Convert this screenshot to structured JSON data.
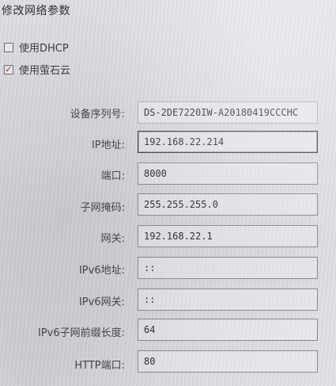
{
  "dialog": {
    "title": "修改网络参数"
  },
  "options": {
    "dhcp": {
      "label": "使用DHCP",
      "checked": false
    },
    "ezviz": {
      "label": "使用萤石云",
      "checked": true
    }
  },
  "fields": [
    {
      "key": "serial",
      "label": "设备序列号:",
      "value": "DS-2DE7220IW-A20180419CCCHC"
    },
    {
      "key": "ip",
      "label": "IP地址:",
      "value": "192.168.22.214"
    },
    {
      "key": "port",
      "label": "端口:",
      "value": "8000"
    },
    {
      "key": "mask",
      "label": "子网掩码:",
      "value": "255.255.255.0"
    },
    {
      "key": "gateway",
      "label": "网关:",
      "value": "192.168.22.1"
    },
    {
      "key": "ipv6",
      "label": "IPv6地址:",
      "value": "::"
    },
    {
      "key": "ipv6gw",
      "label": "IPv6网关:",
      "value": "::"
    },
    {
      "key": "ipv6prefix",
      "label": "IPv6子网前缀长度:",
      "value": "64"
    },
    {
      "key": "http",
      "label": "HTTP端口:",
      "value": "80"
    }
  ],
  "icons": {
    "checkmark": "✓"
  }
}
